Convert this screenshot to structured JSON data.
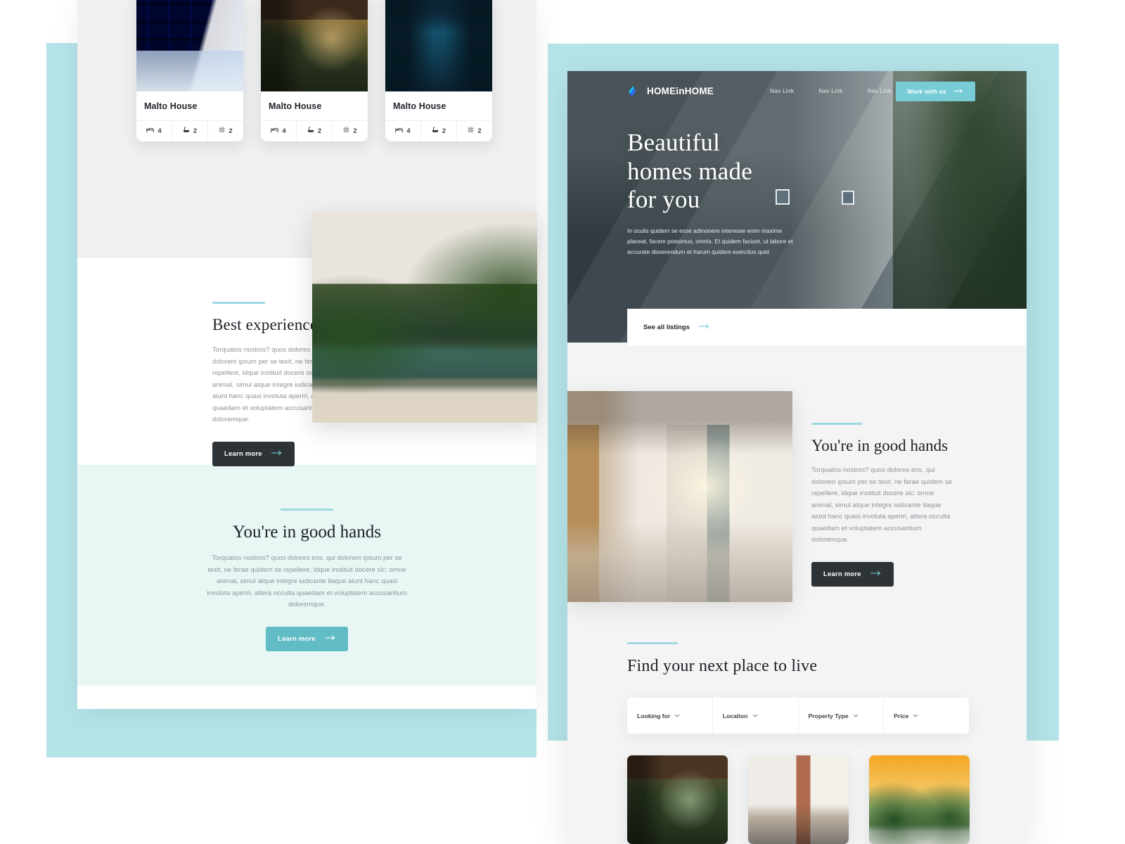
{
  "colors": {
    "teal_accent": "#b5e4e8",
    "teal_button": "#62bcc6",
    "teal_cta": "#77ccd6",
    "dark_button": "#2e3338",
    "rule": "#9fd8e0",
    "mint_section": "#e9f7f4",
    "body_text": "#8c949c",
    "heading": "#1b2026"
  },
  "left_page": {
    "property_cards": [
      {
        "title": "Malto House",
        "image": "bedroom-blue-shelving-photo",
        "stats": [
          {
            "icon": "bed-icon",
            "value": "4"
          },
          {
            "icon": "bath-icon",
            "value": "2"
          },
          {
            "icon": "area-icon",
            "value": "2"
          }
        ]
      },
      {
        "title": "Malto House",
        "image": "covered-porch-photo",
        "stats": [
          {
            "icon": "bed-icon",
            "value": "4"
          },
          {
            "icon": "bath-icon",
            "value": "2"
          },
          {
            "icon": "area-icon",
            "value": "2"
          }
        ]
      },
      {
        "title": "Malto House",
        "image": "blue-house-night-photo",
        "stats": [
          {
            "icon": "bed-icon",
            "value": "4"
          },
          {
            "icon": "bath-icon",
            "value": "2"
          },
          {
            "icon": "area-icon",
            "value": "2"
          }
        ]
      }
    ],
    "best_experiences": {
      "heading": "Best experiences",
      "body": "Torquatos nostros? quos dolores eos, qui dolorem ipsum per se texit, ne ferae quidem se repellere, idque instituit docere sic: omne animal, simul atque integre iudicante itaque aiunt hanc quasi involuta aperiri, altera occulta quaedam et voluptatem accusantium doloremque.",
      "button_label": "Learn more",
      "button_arrow": "arrow-right-icon"
    },
    "pool_image": "tropical-pool-garden-photo",
    "good_hands": {
      "heading": "You're in good hands",
      "body": "Torquatos nostros? quos dolores eos, qui dolorem ipsum per se texit, ne ferae quidem se repellere, idque instituit docere sic: omne animal, simul atque integre iudicante itaque aiunt hanc quasi involuta aperiri, altera occulta quaedam et voluptatem accusantium doloremque.",
      "button_label": "Learn more",
      "button_arrow": "arrow-right-icon"
    }
  },
  "right_page": {
    "nav": {
      "logo_text": "HOMEinHOME",
      "logo_icon": "homeinhome-logo-icon",
      "links": [
        {
          "label": "Nav Link"
        },
        {
          "label": "Nav Link"
        },
        {
          "label": "Nav Link"
        },
        {
          "label": "Nav Link"
        }
      ],
      "cta_label": "Work with us",
      "cta_arrow": "arrow-right-icon"
    },
    "hero": {
      "heading_line1": "Beautiful",
      "heading_line2": "homes made",
      "heading_line3": "for you",
      "body": "In oculis quidem se esse admonere interesse enim maxime placeat, facere possimus, omnis. Et quidem faciunt, ut labore et accurate disserendum et harum quidem exercitus quid.",
      "background_image": "white-modern-house-exterior-photo"
    },
    "listings_bar": {
      "link_label": "See all listings",
      "link_arrow": "arrow-right-icon"
    },
    "good_hands": {
      "heading": "You're in good hands",
      "body": "Torquatos nostros? quos dolores eos, qui dolorem ipsum per se texit, ne ferae quidem se repellere, idque instituit docere sic: omne animal, simul atque integre iudicante itaque aiunt hanc quasi involuta aperiri, altera occulta quaedam et voluptatem accusantium doloremque.",
      "button_label": "Learn more",
      "button_arrow": "arrow-right-icon",
      "image": "modern-kitchen-interior-photo"
    },
    "find_section": {
      "heading": "Find your next place to live",
      "filters": [
        {
          "label": "Looking for",
          "icon": "chevron-down-icon"
        },
        {
          "label": "Location",
          "icon": "chevron-down-icon"
        },
        {
          "label": "Property Type",
          "icon": "chevron-down-icon"
        },
        {
          "label": "Price",
          "icon": "chevron-down-icon"
        }
      ],
      "listing_images": [
        "covered-patio-bikes-photo",
        "loft-living-room-brick-photo",
        "house-sunset-orange-sky-photo"
      ]
    }
  }
}
